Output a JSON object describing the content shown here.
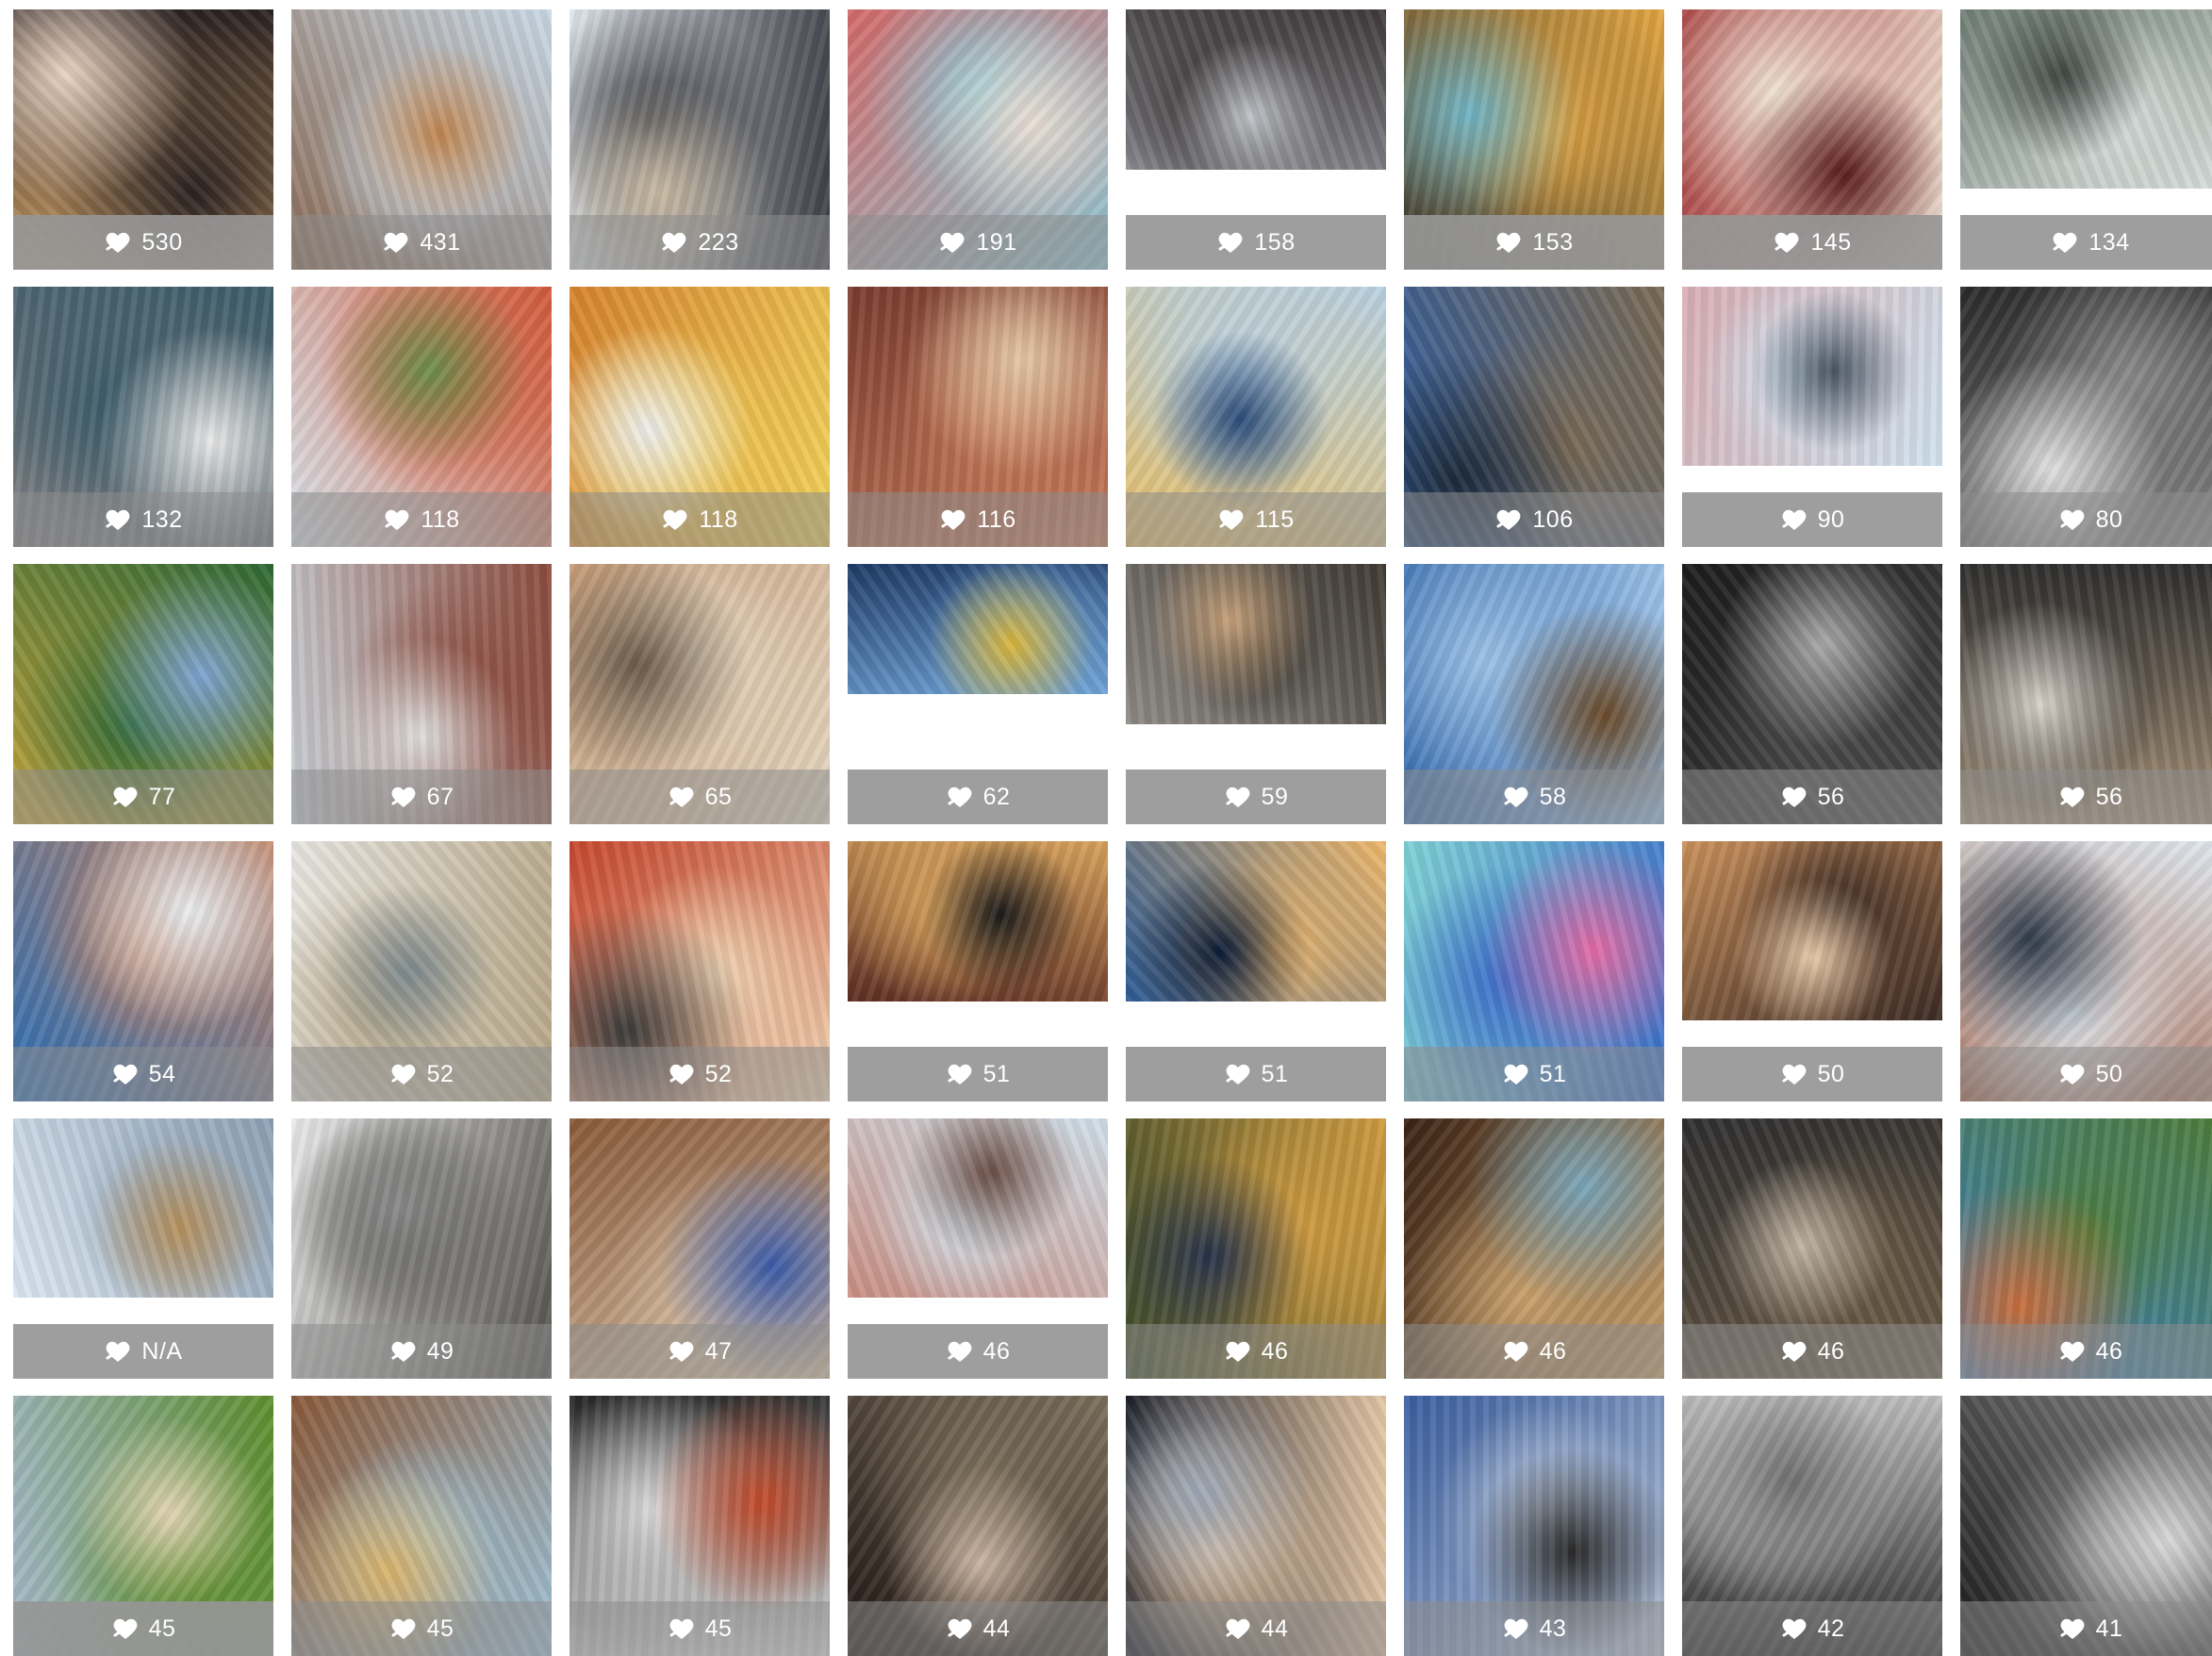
{
  "gallery": {
    "tiles": [
      {
        "likes": "530",
        "colors": [
          "#c79a62",
          "#2a2222",
          "#e9d2c2"
        ],
        "photo": "full",
        "overlay": false
      },
      {
        "likes": "431",
        "colors": [
          "#8a6a55",
          "#c9d9e6",
          "#c0854f"
        ],
        "photo": "full",
        "overlay": true
      },
      {
        "likes": "223",
        "colors": [
          "#dfe5ea",
          "#3d3f46",
          "#c8b9a2"
        ],
        "photo": "full",
        "overlay": true
      },
      {
        "likes": "191",
        "colors": [
          "#d46a6a",
          "#8ec9d6",
          "#e9ddd3"
        ],
        "photo": "full",
        "overlay": true
      },
      {
        "likes": "158",
        "colors": [
          "#8b8c93",
          "#3f3a3a",
          "#bfc2c7"
        ],
        "photo": "short",
        "overlay": false
      },
      {
        "likes": "153",
        "colors": [
          "#3b3f3a",
          "#e2a43f",
          "#6fb3c5"
        ],
        "photo": "full",
        "overlay": false
      },
      {
        "likes": "145",
        "colors": [
          "#a63a3a",
          "#efe1d3",
          "#5a1d1d"
        ],
        "photo": "full",
        "overlay": false
      },
      {
        "likes": "134",
        "colors": [
          "#6f7d74",
          "#d9dfdc",
          "#3f4642"
        ],
        "photo": "mid",
        "overlay": false
      },
      {
        "likes": "132",
        "colors": [
          "#7f7f82",
          "#3d5d6b",
          "#e7e7e7"
        ],
        "photo": "full",
        "overlay": true
      },
      {
        "likes": "118",
        "colors": [
          "#d9e2ea",
          "#d25a3a",
          "#6c8f4f"
        ],
        "photo": "full",
        "overlay": true
      },
      {
        "likes": "118",
        "colors": [
          "#d6832e",
          "#f2d25a",
          "#ececec"
        ],
        "photo": "full",
        "overlay": true
      },
      {
        "likes": "116",
        "colors": [
          "#7a3c2f",
          "#c97c5b",
          "#e2c7a5"
        ],
        "photo": "full",
        "overlay": true
      },
      {
        "likes": "115",
        "colors": [
          "#e7c06b",
          "#b9d1e2",
          "#2b4c79"
        ],
        "photo": "full",
        "overlay": true
      },
      {
        "likes": "106",
        "colors": [
          "#2e5c9f",
          "#7b6a53",
          "#1d2a3a"
        ],
        "photo": "full",
        "overlay": true
      },
      {
        "likes": "90",
        "colors": [
          "#d9aeb3",
          "#cfe2ef",
          "#4a5563"
        ],
        "photo": "mid",
        "overlay": false
      },
      {
        "likes": "80",
        "colors": [
          "#2a2a2a",
          "#8a8a8a",
          "#e0e0e0"
        ],
        "photo": "full",
        "overlay": true
      },
      {
        "likes": "77",
        "colors": [
          "#c6a53c",
          "#2f6a36",
          "#7da3d1"
        ],
        "photo": "full",
        "overlay": true
      },
      {
        "likes": "67",
        "colors": [
          "#c9d0d6",
          "#8b4a3c",
          "#dedede"
        ],
        "photo": "full",
        "overlay": true
      },
      {
        "likes": "65",
        "colors": [
          "#c49b77",
          "#e6d8c2",
          "#6b5a4a"
        ],
        "photo": "full",
        "overlay": true
      },
      {
        "likes": "62",
        "colors": [
          "#1f3b66",
          "#6ea2d6",
          "#d8b53a"
        ],
        "photo": "banner",
        "overlay": false
      },
      {
        "likes": "59",
        "colors": [
          "#8d8a86",
          "#3f3a33",
          "#c5a07a"
        ],
        "photo": "short",
        "overlay": false
      },
      {
        "likes": "58",
        "colors": [
          "#3b6fb0",
          "#9ac0e6",
          "#6b4b2a"
        ],
        "photo": "full",
        "overlay": true
      },
      {
        "likes": "56",
        "colors": [
          "#1c1c1c",
          "#4a4a4a",
          "#a9a9a9"
        ],
        "photo": "full",
        "overlay": true
      },
      {
        "likes": "56",
        "colors": [
          "#a89378",
          "#2e2e2e",
          "#d9d2c9"
        ],
        "photo": "full",
        "overlay": true
      },
      {
        "likes": "54",
        "colors": [
          "#2d6fb6",
          "#c28566",
          "#e9ecef"
        ],
        "photo": "full",
        "overlay": true
      },
      {
        "likes": "52",
        "colors": [
          "#e8e6e1",
          "#b8a98a",
          "#7e8a8e"
        ],
        "photo": "full",
        "overlay": true
      },
      {
        "likes": "52",
        "colors": [
          "#c6472d",
          "#f0d6b5",
          "#3b3b3b"
        ],
        "photo": "full",
        "overlay": true
      },
      {
        "likes": "51",
        "colors": [
          "#5d2d23",
          "#d6a15b",
          "#1b1b1b"
        ],
        "photo": "short",
        "overlay": false
      },
      {
        "likes": "51",
        "colors": [
          "#2c5a94",
          "#f0b86a",
          "#0c1c36"
        ],
        "photo": "short",
        "overlay": false
      },
      {
        "likes": "51",
        "colors": [
          "#7fd1d6",
          "#3b6ec9",
          "#e46aa5"
        ],
        "photo": "full",
        "overlay": true
      },
      {
        "likes": "50",
        "colors": [
          "#c98f5a",
          "#3b2a24",
          "#e8c9a8"
        ],
        "photo": "mid",
        "overlay": false
      },
      {
        "likes": "50",
        "colors": [
          "#a5674f",
          "#dfe7ee",
          "#2f3b4b"
        ],
        "photo": "full",
        "overlay": true
      },
      {
        "likes": "N/A",
        "colors": [
          "#dbe7f2",
          "#8c9fb3",
          "#b7925e"
        ],
        "photo": "mid",
        "overlay": false
      },
      {
        "likes": "49",
        "colors": [
          "#e9e9e9",
          "#514f4a",
          "#8a8a8a"
        ],
        "photo": "full",
        "overlay": true
      },
      {
        "likes": "47",
        "colors": [
          "#8a5a3a",
          "#d7c0a5",
          "#3b5aa8"
        ],
        "photo": "full",
        "overlay": true
      },
      {
        "likes": "46",
        "colors": [
          "#c98f83",
          "#d0dfe9",
          "#6b4f46"
        ],
        "photo": "mid",
        "overlay": false
      },
      {
        "likes": "46",
        "colors": [
          "#3d4b2a",
          "#cf9b3f",
          "#25324a"
        ],
        "photo": "full",
        "overlay": true
      },
      {
        "likes": "46",
        "colors": [
          "#3a2214",
          "#c8a06b",
          "#7aa5b8"
        ],
        "photo": "full",
        "overlay": true
      },
      {
        "likes": "46",
        "colors": [
          "#2f2f30",
          "#6a5a46",
          "#bfb3a3"
        ],
        "photo": "full",
        "overlay": true
      },
      {
        "likes": "46",
        "colors": [
          "#3d7fc7",
          "#4e7d3a",
          "#c86d3b"
        ],
        "photo": "full",
        "overlay": true
      },
      {
        "likes": "45",
        "colors": [
          "#a3b9c9",
          "#5e8f2e",
          "#e2d4b4"
        ],
        "photo": "full",
        "overlay": false
      },
      {
        "likes": "45",
        "colors": [
          "#8a5a3a",
          "#9fc3d8",
          "#d9b36b"
        ],
        "photo": "full",
        "overlay": true
      },
      {
        "likes": "45",
        "colors": [
          "#262626",
          "#d9d9d9",
          "#c24a2a"
        ],
        "photo": "full",
        "overlay": true
      },
      {
        "likes": "44",
        "colors": [
          "#201815",
          "#7b6e5b",
          "#c9b3a1"
        ],
        "photo": "full",
        "overlay": true
      },
      {
        "likes": "44",
        "colors": [
          "#171a25",
          "#e4c6a5",
          "#9fa9b7"
        ],
        "photo": "full",
        "overlay": true
      },
      {
        "likes": "43",
        "colors": [
          "#3a5e9f",
          "#b9c6d9",
          "#2a2a2a"
        ],
        "photo": "full",
        "overlay": true
      },
      {
        "likes": "42",
        "colors": [
          "#2a2a2a",
          "#bdbdbd",
          "#6f6f6f"
        ],
        "photo": "full",
        "overlay": true
      },
      {
        "likes": "41",
        "colors": [
          "#1b1b1b",
          "#8a8a8a",
          "#d8d8d8"
        ],
        "photo": "full",
        "overlay": true
      }
    ]
  }
}
